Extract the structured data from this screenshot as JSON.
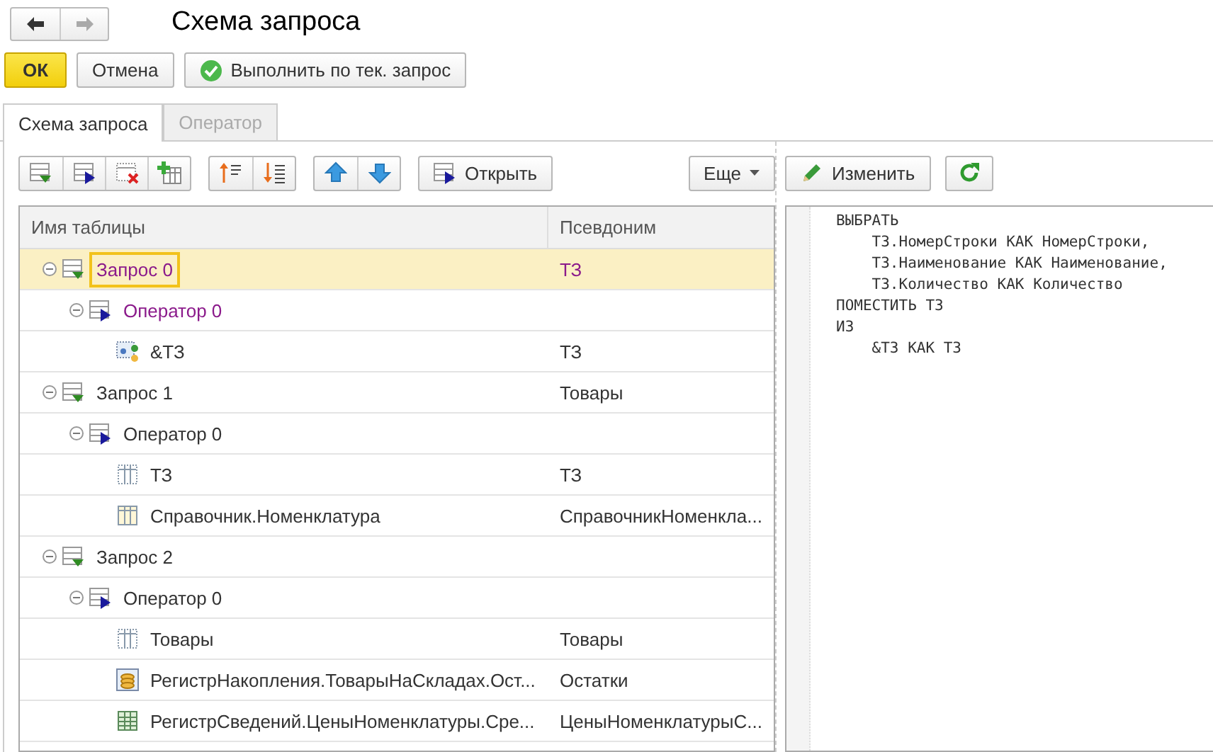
{
  "window": {
    "title": "Схема запроса"
  },
  "actions": [
    {
      "label": "ОК",
      "kind": "default"
    },
    {
      "label": "Отмена",
      "kind": "plain"
    },
    {
      "label": "Выполнить по тек. запрос",
      "kind": "run"
    }
  ],
  "tabs": [
    {
      "label": "Схема запроса",
      "selected": true
    },
    {
      "label": "Оператор",
      "selected": false
    }
  ],
  "toolbar": {
    "open_button": "Открыть",
    "more_button": "Еще"
  },
  "table": {
    "columns": [
      "Имя таблицы",
      "Псевдоним"
    ],
    "rows": [
      {
        "kind": "query",
        "name": "Запрос 0",
        "alias": "ТЗ",
        "selected": true,
        "current": true,
        "children": [
          {
            "kind": "operator",
            "name": "Оператор 0",
            "current": true,
            "selected": false,
            "children": [
              {
                "kind": "parameter",
                "name": "&ТЗ",
                "alias": "ТЗ",
                "selected": false,
                "current": false
              }
            ]
          }
        ]
      },
      {
        "kind": "query",
        "name": "Запрос 1",
        "alias": "Товары",
        "selected": false,
        "current": false,
        "children": [
          {
            "kind": "operator",
            "name": "Оператор 0",
            "selected": false,
            "current": false,
            "children": [
              {
                "kind": "temp",
                "name": "ТЗ",
                "alias": "ТЗ",
                "selected": false,
                "current": false
              },
              {
                "kind": "catalog",
                "name": "Справочник.Номенклатура",
                "alias": "СправочникНоменкла...",
                "selected": false,
                "current": false
              }
            ]
          }
        ]
      },
      {
        "kind": "query",
        "name": "Запрос 2",
        "selected": false,
        "current": false,
        "children": [
          {
            "kind": "operator",
            "name": "Оператор 0",
            "selected": false,
            "current": false,
            "children": [
              {
                "kind": "temp",
                "name": "Товары",
                "alias": "Товары",
                "selected": false,
                "current": false
              },
              {
                "kind": "accumulation",
                "name": "РегистрНакопления.ТоварыНаСкладах.Ост...",
                "alias": "Остатки",
                "selected": false,
                "current": false
              },
              {
                "kind": "information",
                "name": "РегистрСведений.ЦеныНоменклатуры.Сре...",
                "alias": "ЦеныНоменклатурыС...",
                "selected": false,
                "current": false
              }
            ]
          }
        ]
      }
    ]
  },
  "text_panel": {
    "edit_button": "Изменить",
    "code": [
      "ВЫБРАТЬ",
      "    ТЗ.НомерСтроки КАК НомерСтроки,",
      "    ТЗ.Наименование КАК Наименование,",
      "    ТЗ.Количество КАК Количество",
      "ПОМЕСТИТЬ ТЗ",
      "ИЗ",
      "    &ТЗ КАК ТЗ"
    ]
  }
}
